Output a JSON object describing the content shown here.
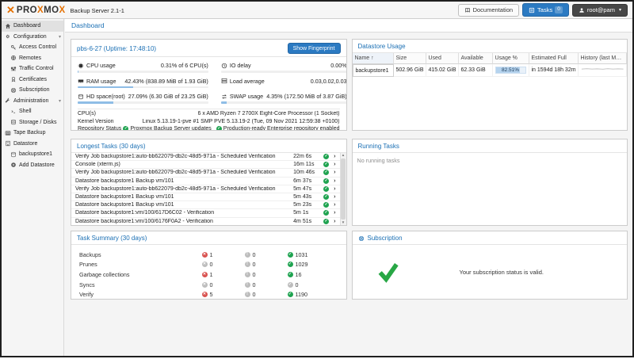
{
  "colors": {
    "accent_blue": "#1a6fb4",
    "button_blue": "#2b7ac2",
    "ok_green": "#1fa350",
    "error_red": "#d95350",
    "neutral_gray": "#bdbdbd",
    "logo_orange": "#e57000"
  },
  "topbar": {
    "logo_p1": "PRO",
    "logo_x1": "X",
    "logo_p2": "MO",
    "logo_x2": "X",
    "product": "Backup Server 2.1-1",
    "documentation_label": "Documentation",
    "tasks_label": "Tasks",
    "tasks_badge": "0",
    "user_label": "root@pam"
  },
  "breadcrumb": "Dashboard",
  "sidebar": {
    "items": [
      {
        "label": "Dashboard"
      },
      {
        "label": "Configuration"
      },
      {
        "label": "Access Control"
      },
      {
        "label": "Remotes"
      },
      {
        "label": "Traffic Control"
      },
      {
        "label": "Certificates"
      },
      {
        "label": "Subscription"
      },
      {
        "label": "Administration"
      },
      {
        "label": "Shell"
      },
      {
        "label": "Storage / Disks"
      },
      {
        "label": "Tape Backup"
      },
      {
        "label": "Datastore"
      },
      {
        "label": "backupstore1"
      },
      {
        "label": "Add Datastore"
      }
    ]
  },
  "status_panel": {
    "title": "pbs-6-27 (Uptime: 17:48:10)",
    "fingerprint_button": "Show Fingerprint",
    "stats": [
      {
        "label": "CPU usage",
        "value": "0.31% of 6 CPU(s)",
        "pct": 0.31
      },
      {
        "label": "IO delay",
        "value": "0.00%",
        "pct": 0
      },
      {
        "label": "RAM usage",
        "value": "42.43% (838.89 MiB of 1.93 GiB)",
        "pct": 42.43
      },
      {
        "label": "Load average",
        "value": "0.03,0.02,0.03"
      },
      {
        "label": "HD space(root)",
        "value": "27.09% (6.30 GiB of 23.25 GiB)",
        "pct": 27.09
      },
      {
        "label": "SWAP usage",
        "value": "4.35% (172.50 MiB of 3.87 GiB)",
        "pct": 4.35
      }
    ],
    "info": [
      {
        "label": "CPU(s)",
        "value": "6 x AMD Ryzen 7 2700X Eight-Core Processor (1 Socket)"
      },
      {
        "label": "Kernel Version",
        "value": "Linux 5.13.19-1-pve #1 SMP PVE 5.13.19-2 (Tue, 09 Nov 2021 12:59:38 +0100)"
      },
      {
        "label": "Repository Status",
        "part1": "Proxmox Backup Server updates",
        "part2": "Production-ready Enterprise repository enabled"
      }
    ]
  },
  "longest_tasks": {
    "title": "Longest Tasks (30 days)",
    "rows": [
      {
        "task": "Verify Job backupstore1:auto-bb622079-db2c-48d5-971a - Scheduled Verification",
        "duration": "22m 6s"
      },
      {
        "task": "Console (xterm.js)",
        "duration": "16m 11s"
      },
      {
        "task": "Verify Job backupstore1:auto-bb622079-db2c-48d5-971a - Scheduled Verification",
        "duration": "10m 46s"
      },
      {
        "task": "Datastore backupstore1 Backup vm/101",
        "duration": "6m 37s"
      },
      {
        "task": "Verify Job backupstore1:auto-bb622079-db2c-48d5-971a - Scheduled Verification",
        "duration": "5m 47s"
      },
      {
        "task": "Datastore backupstore1 Backup vm/101",
        "duration": "5m 43s"
      },
      {
        "task": "Datastore backupstore1 Backup vm/101",
        "duration": "5m 23s"
      },
      {
        "task": "Datastore backupstore1:vm/100/617D6C02 - Verification",
        "duration": "5m 1s"
      },
      {
        "task": "Datastore backupstore1:vm/100/6176F0A2 - Verification",
        "duration": "4m 51s"
      }
    ]
  },
  "task_summary": {
    "title": "Task Summary (30 days)",
    "rows": [
      {
        "label": "Backups",
        "error": "1",
        "warning": "0",
        "ok": "1031",
        "err_cls": "sicon t-err red",
        "warn_cls": "sicon t-warn gray",
        "ok_cls": "sicon t-ok green"
      },
      {
        "label": "Prunes",
        "error": "0",
        "warning": "0",
        "ok": "1029",
        "err_cls": "sicon t-err gray",
        "warn_cls": "sicon t-warn gray",
        "ok_cls": "sicon t-ok green"
      },
      {
        "label": "Garbage collections",
        "error": "1",
        "warning": "0",
        "ok": "16",
        "err_cls": "sicon t-err red",
        "warn_cls": "sicon t-warn gray",
        "ok_cls": "sicon t-ok green"
      },
      {
        "label": "Syncs",
        "error": "0",
        "warning": "0",
        "ok": "0",
        "err_cls": "sicon t-err gray",
        "warn_cls": "sicon t-warn gray",
        "ok_cls": "sicon t-ok gray"
      },
      {
        "label": "Verify",
        "error": "5",
        "warning": "0",
        "ok": "1190",
        "err_cls": "sicon t-err red",
        "warn_cls": "sicon t-warn gray",
        "ok_cls": "sicon t-ok green"
      }
    ]
  },
  "datastore_usage": {
    "title": "Datastore Usage",
    "columns": {
      "name": "Name",
      "sort_arrow": "↑",
      "size": "Size",
      "used": "Used",
      "available": "Available",
      "usage": "Usage %",
      "estimated_full": "Estimated Full",
      "history": "History (last Month)"
    },
    "rows": [
      {
        "name": "backupstore1",
        "size": "502.96 GiB",
        "used": "415.02 GiB",
        "available": "62.33 GiB",
        "usage": "82.51%",
        "usage_pct": 82.51,
        "estimated_full": "in 1594d 18h 32m"
      }
    ]
  },
  "running_tasks": {
    "title": "Running Tasks",
    "empty": "No running tasks"
  },
  "subscription": {
    "title": "Subscription",
    "message": "Your subscription status is valid."
  }
}
